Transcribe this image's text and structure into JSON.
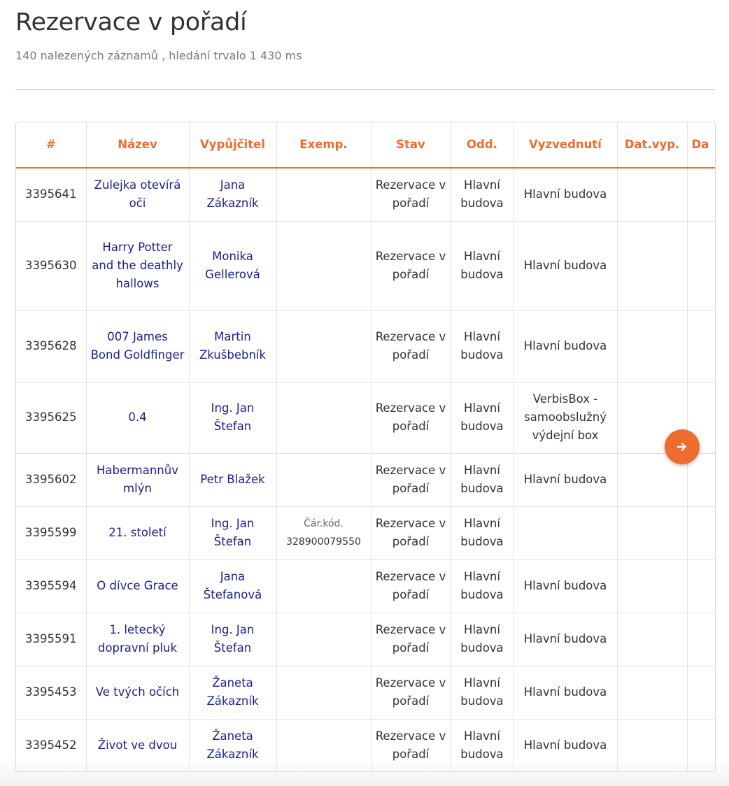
{
  "page": {
    "title": "Rezervace v pořadí",
    "subtitle": "140 nalezených záznamů , hledání trvalo 1 430 ms"
  },
  "table": {
    "columns": [
      "#",
      "Název",
      "Vypůjčitel",
      "Exemp.",
      "Stav",
      "Odd.",
      "Vyzvednutí",
      "Dat.vyp.",
      "Da"
    ],
    "rows": [
      {
        "id": "3395641",
        "title": "Zulejka otevírá oči",
        "borrower": "Jana Zákazník",
        "copy": null,
        "status": "Rezervace v pořadí",
        "dept": "Hlavní budova",
        "pickup": "Hlavní budova",
        "date": ""
      },
      {
        "id": "3395630",
        "title": "Harry Potter and the deathly hallows",
        "borrower": "Monika Gellerová",
        "copy": null,
        "status": "Rezervace v pořadí",
        "dept": "Hlavní budova",
        "pickup": "Hlavní budova",
        "date": ""
      },
      {
        "id": "3395628",
        "title": "007 James Bond Goldfinger",
        "borrower": "Martin Zkušbebník",
        "copy": null,
        "status": "Rezervace v pořadí",
        "dept": "Hlavní budova",
        "pickup": "Hlavní budova",
        "date": ""
      },
      {
        "id": "3395625",
        "title": "0.4",
        "borrower": "Ing. Jan Štefan",
        "copy": null,
        "status": "Rezervace v pořadí",
        "dept": "Hlavní budova",
        "pickup": "VerbisBox - samoobslužný výdejní box",
        "date": ""
      },
      {
        "id": "3395602",
        "title": "Habermannův mlýn",
        "borrower": "Petr Blažek",
        "copy": null,
        "status": "Rezervace v pořadí",
        "dept": "Hlavní budova",
        "pickup": "Hlavní budova",
        "date": ""
      },
      {
        "id": "3395599",
        "title": "21. století",
        "borrower": "Ing. Jan Štefan",
        "copy": {
          "label": "Čár.kód.",
          "value": "328900079550"
        },
        "status": "Rezervace v pořadí",
        "dept": "Hlavní budova",
        "pickup": "",
        "date": ""
      },
      {
        "id": "3395594",
        "title": "O dívce Grace",
        "borrower": "Jana Štefanová",
        "copy": null,
        "status": "Rezervace v pořadí",
        "dept": "Hlavní budova",
        "pickup": "Hlavní budova",
        "date": ""
      },
      {
        "id": "3395591",
        "title": "1. letecký dopravní pluk",
        "borrower": "Ing. Jan Štefan",
        "copy": null,
        "status": "Rezervace v pořadí",
        "dept": "Hlavní budova",
        "pickup": "Hlavní budova",
        "date": ""
      },
      {
        "id": "3395453",
        "title": "Ve tvých očích",
        "borrower": "Žaneta Zákazník",
        "copy": null,
        "status": "Rezervace v pořadí",
        "dept": "Hlavní budova",
        "pickup": "Hlavní budova",
        "date": ""
      },
      {
        "id": "3395452",
        "title": "Život ve dvou",
        "borrower": "Žaneta Zákazník",
        "copy": null,
        "status": "Rezervace v pořadí",
        "dept": "Hlavní budova",
        "pickup": "Hlavní budova",
        "date": ""
      }
    ]
  },
  "scroll_button": {
    "icon": "arrow-right-icon"
  },
  "colors": {
    "accent": "#ef6c2f",
    "link": "#1a1f8c",
    "text": "#333333",
    "muted": "#7a7a7a"
  }
}
